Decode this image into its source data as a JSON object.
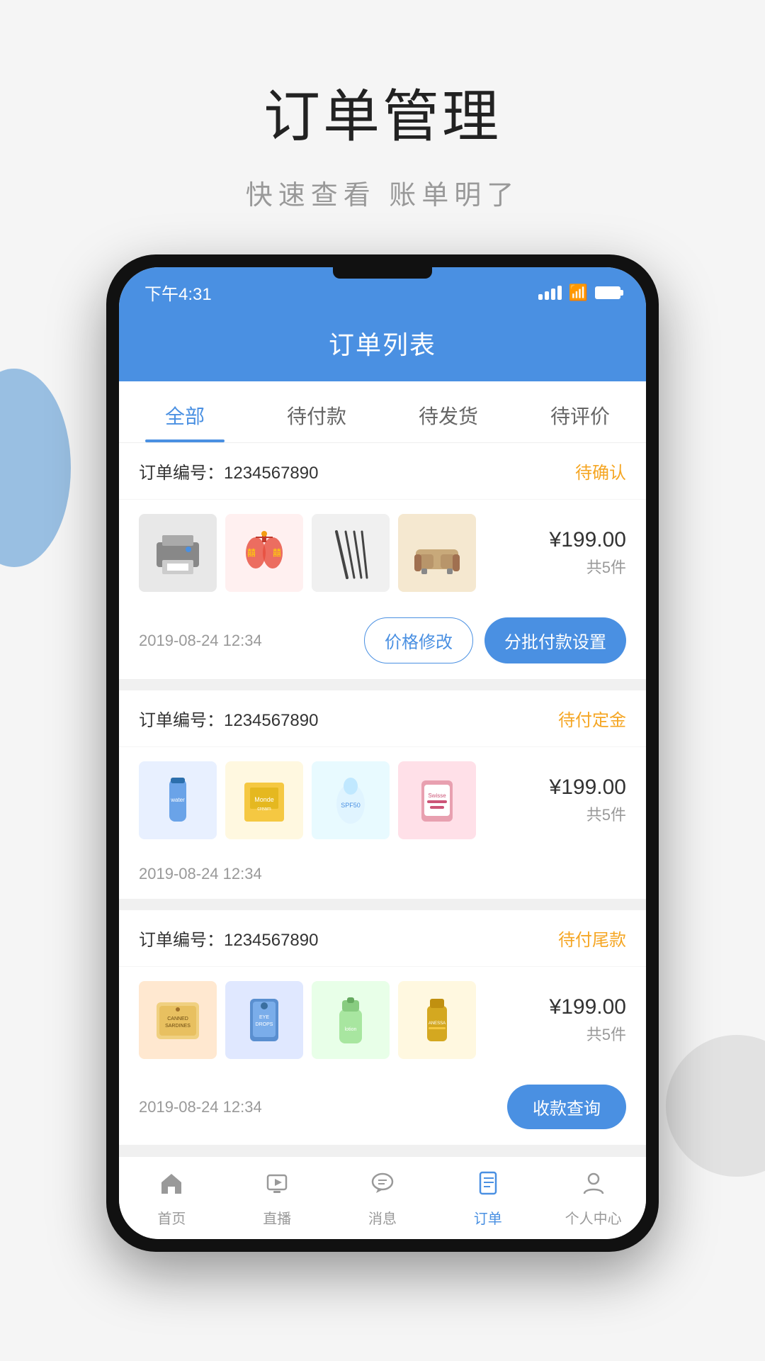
{
  "page": {
    "title": "订单管理",
    "subtitle": "快速查看  账单明了"
  },
  "status_bar": {
    "time": "下午4:31",
    "accent_color": "#4a90e2"
  },
  "app_header": {
    "title": "订单列表"
  },
  "tabs": [
    {
      "label": "全部",
      "active": true
    },
    {
      "label": "待付款",
      "active": false
    },
    {
      "label": "待发货",
      "active": false
    },
    {
      "label": "待评价",
      "active": false
    }
  ],
  "orders": [
    {
      "id": "order-1",
      "number_label": "订单编号：",
      "number": "1234567890",
      "status": "待确认",
      "price": "¥199.00",
      "count": "共5件",
      "date": "2019-08-24 12:34",
      "products": [
        "🖨️",
        "🧧",
        "📏",
        "🛋️"
      ],
      "actions": [
        {
          "label": "价格修改",
          "type": "outline"
        },
        {
          "label": "分批付款设置",
          "type": "filled"
        }
      ]
    },
    {
      "id": "order-2",
      "number_label": "订单编号：",
      "number": "1234567890",
      "status": "待付定金",
      "price": "¥199.00",
      "count": "共5件",
      "date": "2019-08-24 12:34",
      "products": [
        "🧴",
        "📦",
        "🧴",
        "💊"
      ],
      "actions": []
    },
    {
      "id": "order-3",
      "number_label": "订单编号：",
      "number": "1234567890",
      "status": "待付尾款",
      "price": "¥199.00",
      "count": "共5件",
      "date": "2019-08-24 12:34",
      "products": [
        "🥫",
        "💧",
        "🧴",
        "✨"
      ],
      "actions": [
        {
          "label": "收款查询",
          "type": "filled"
        }
      ]
    }
  ],
  "bottom_nav": [
    {
      "label": "首页",
      "icon": "home",
      "active": false
    },
    {
      "label": "直播",
      "icon": "live",
      "active": false
    },
    {
      "label": "消息",
      "icon": "message",
      "active": false
    },
    {
      "label": "订单",
      "icon": "order",
      "active": true
    },
    {
      "label": "个人中心",
      "icon": "profile",
      "active": false
    }
  ]
}
